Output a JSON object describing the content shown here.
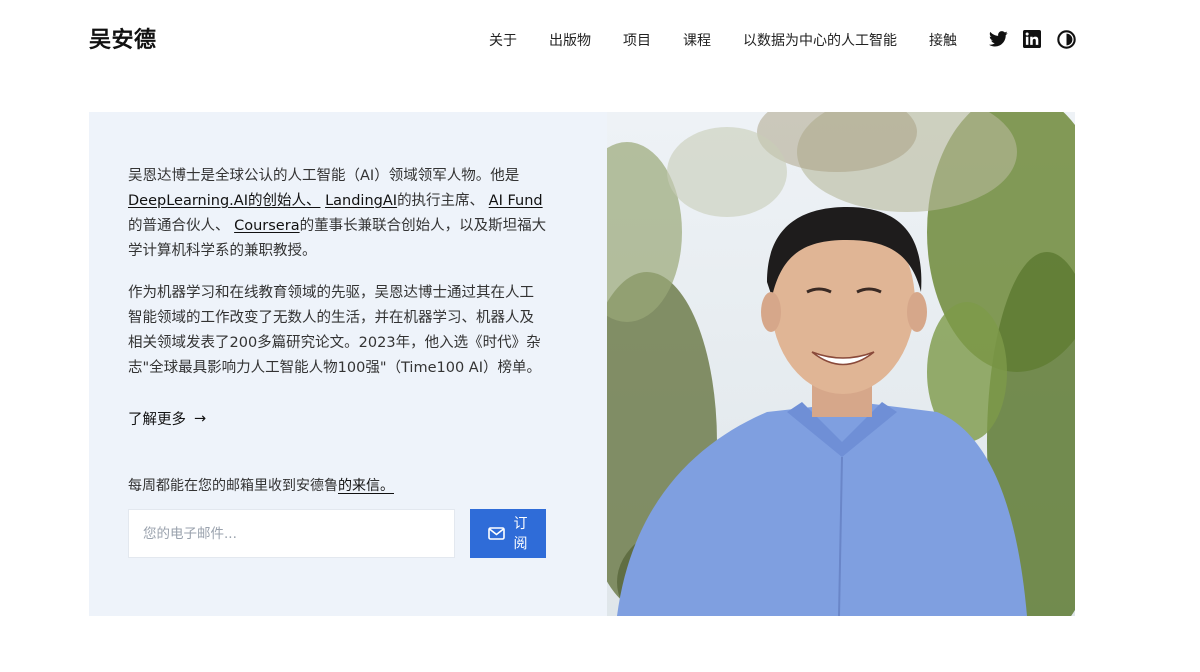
{
  "header": {
    "brand": "吴安德",
    "nav": [
      "关于",
      "出版物",
      "项目",
      "课程",
      "以数据为中心的人工智能",
      "接触"
    ],
    "social_icons": [
      "twitter-icon",
      "linkedin-icon",
      "blog-icon"
    ]
  },
  "hero": {
    "bio_p1_a": "吴恩达博士是全球公认的人工智能（AI）领域领军人物。他是",
    "bio_p1_link1": "DeepLearning.AI的创始人、",
    "bio_p1_sep1": " ",
    "bio_p1_link2": "LandingAI",
    "bio_p1_b": "的执行主席、 ",
    "bio_p1_link3": "AI Fund",
    "bio_p1_c": "的普通合伙人、 ",
    "bio_p1_link4": "Coursera",
    "bio_p1_d": "的董事长兼联合创始人，以及斯坦福大学计算机科学系的兼职教授。",
    "bio_p2": "作为机器学习和在线教育领域的先驱，吴恩达博士通过其在人工智能领域的工作改变了无数人的生活，并在机器学习、机器人及相关领域发表了200多篇研究论文。2023年，他入选《时代》杂志\"全球最具影响力人工智能人物100强\"（Time100 AI）榜单。",
    "learn_more": "了解更多",
    "arrow": "→",
    "newsletter_a": "每周都能在您的邮箱里收到安德鲁",
    "newsletter_link": "的来信。",
    "email_placeholder": "您的电子邮件...",
    "subscribe_label": "订阅"
  },
  "colors": {
    "accent": "#2f6cd8",
    "panel_bg": "#eef3fa"
  }
}
